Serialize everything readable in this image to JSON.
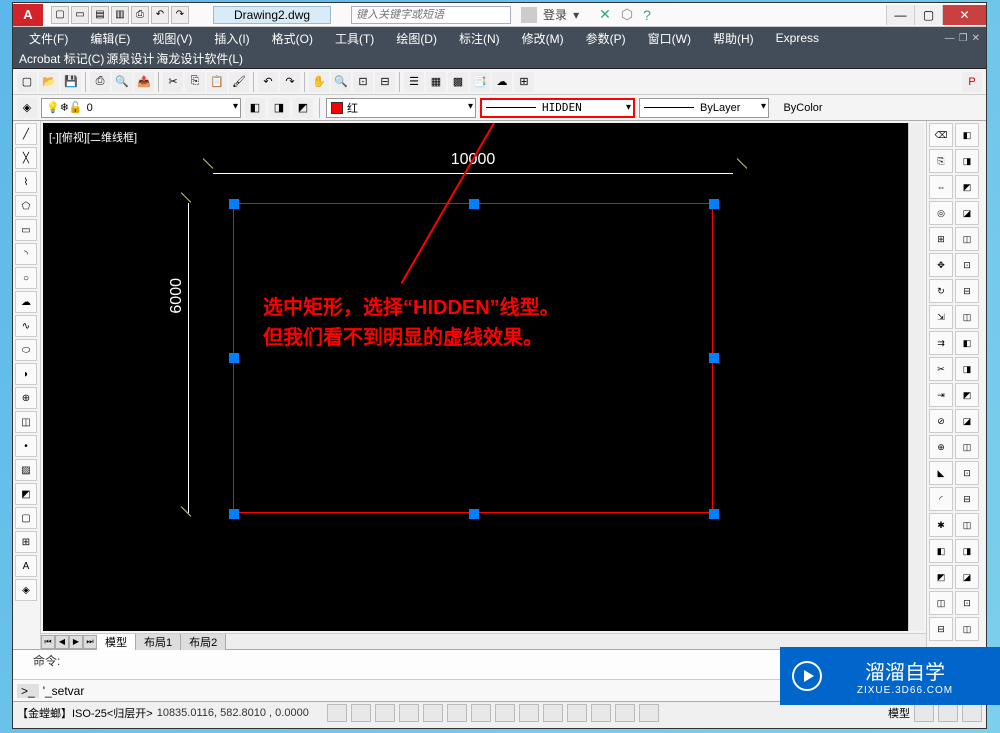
{
  "titlebar": {
    "logo": "A",
    "filename": "Drawing2.dwg",
    "search_placeholder": "键入关键字或短语",
    "login": "登录"
  },
  "menus": {
    "row1": [
      "文件(F)",
      "编辑(E)",
      "视图(V)",
      "插入(I)",
      "格式(O)",
      "工具(T)",
      "绘图(D)",
      "标注(N)",
      "修改(M)",
      "参数(P)",
      "窗口(W)",
      "帮助(H)",
      "Express"
    ],
    "row2": [
      "Acrobat 标记(C)",
      "源泉设计",
      "海龙设计软件(L)"
    ]
  },
  "props": {
    "layer": "0",
    "color": "红",
    "linetype": "HIDDEN",
    "lineweight": "ByLayer",
    "plotstyle": "ByColor"
  },
  "canvas": {
    "viewport_label": "[-][俯视][二维线框]",
    "dim_top": "10000",
    "dim_left": "6000",
    "annotation_line1": "选中矩形，选择“HIDDEN”线型。",
    "annotation_line2": "但我们看不到明显的虚线效果。"
  },
  "tabs": {
    "model": "模型",
    "layout1": "布局1",
    "layout2": "布局2"
  },
  "cmd": {
    "history": "命令:",
    "prompt": ">_",
    "input": "'_setvar"
  },
  "status": {
    "left": "【金螳螂】ISO-25<归层开>",
    "coords": "10835.0116, 582.8010 , 0.0000",
    "right": "模型"
  },
  "watermark": {
    "main": "溜溜自学",
    "sub": "ZIXUE.3D66.COM"
  }
}
